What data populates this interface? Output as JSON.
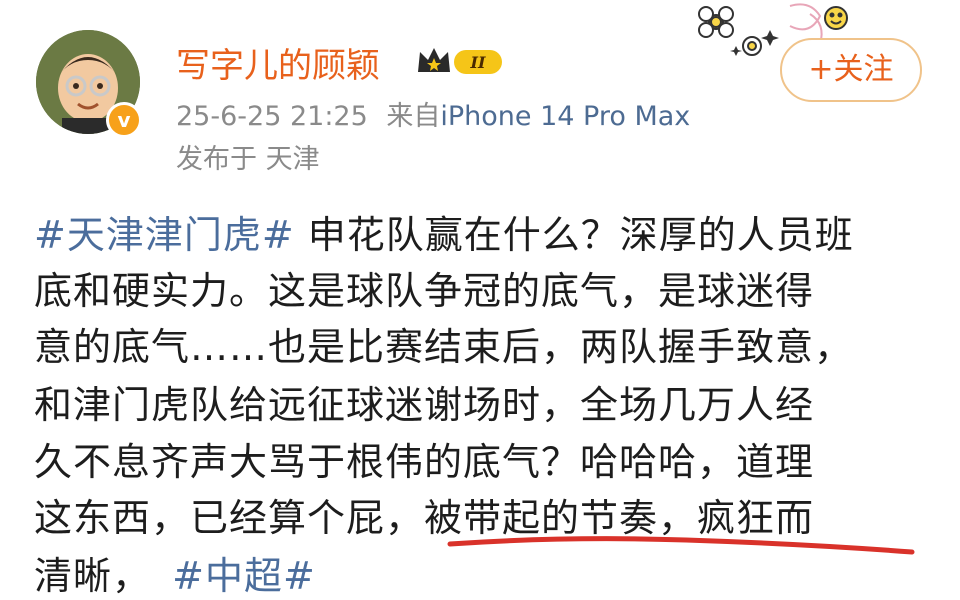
{
  "header": {
    "username": "写字儿的顾颖",
    "badge_text": "II",
    "timestamp": "25-6-25 21:25",
    "source_prefix": "来自",
    "device": "iPhone 14 Pro Max",
    "location": "发布于 天津",
    "follow_label": "+关注",
    "verified_mark": "v"
  },
  "post": {
    "lines": [
      {
        "tag": "#天津津门虎#",
        "text": " 申花队赢在什么？深厚的人员班"
      },
      {
        "tag": "",
        "text": "底和硬实力。这是球队争冠的底气，是球迷得"
      },
      {
        "tag": "",
        "text": "意的底气……也是比赛结束后，两队握手致意，"
      },
      {
        "tag": "",
        "text": "和津门虎队给远征球迷谢场时，全场几万人经"
      },
      {
        "tag": "",
        "text": "久不息齐声大骂于根伟的底气？哈哈哈，道理"
      },
      {
        "tag": "",
        "text": "这东西，已经算个屁，被带起的节奏，疯狂而"
      },
      {
        "tag": "#中超#",
        "text": "清晰，",
        "tag_after": true
      }
    ]
  },
  "colors": {
    "accent": "#e8611c",
    "link": "#4b6d9c",
    "underline": "#d9322a"
  }
}
